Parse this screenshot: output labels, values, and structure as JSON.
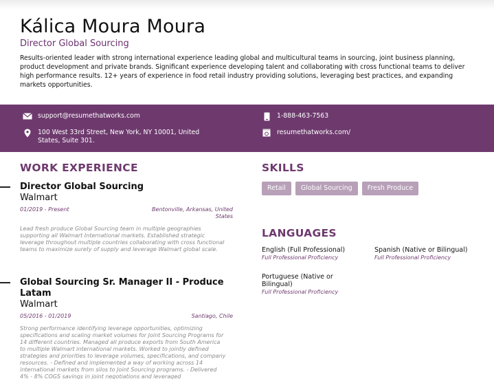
{
  "header": {
    "name": "Kálica Moura Moura",
    "title": "Director Global Sourcing",
    "summary": "Results-oriented leader with strong international experience leading global and multicultural teams in sourcing, joint business planning, product development and private brands. Significant experience developing talent and collaborating with cross functional teams to deliver high performance results. 12+ years of experience in food retail industry providing solutions, leveraging best practices, and expanding markets opportunities."
  },
  "contact": {
    "email": "support@resumethatworks.com",
    "address": "100 West 33rd Street, New York, NY 10001, United States, Suite 301.",
    "phone": "1-888-463-7563",
    "website": "resumethatworks.com/",
    "icons": [
      "envelope-icon",
      "location-pin-icon",
      "phone-icon",
      "web-icon"
    ],
    "bar_color": "#6e3a6e"
  },
  "work": {
    "heading": "WORK EXPERIENCE",
    "jobs": [
      {
        "title": "Director Global Sourcing",
        "company": "Walmart",
        "dates": "01/2019 - Present",
        "location": "Bentonville, Arkansas, United States",
        "description": "Lead fresh produce Global Sourcing team in multiple geographies supporting all Walmart International markets. Established strategic leverage throughout multiple countries collaborating with cross functional teams to maximize surety of supply and leverage Walmart global scale."
      },
      {
        "title": "Global Sourcing Sr. Manager II - Produce Latam",
        "company": "Walmart",
        "dates": "05/2016 - 01/2019",
        "location": "Santiago, Chile",
        "description": "Strong performance identifying leverage opportunities, optimizing specifications and scaling market volumes for Joint Sourcing Programs for 14 different countries. Managed all produce exports from South America to multiple Walmart international markets. Worked to jointly defined strategies and priorities to leverage volumes, specifications, and company resources. - Defined and implemented a way of working across 14 international markets from silos to Joint Sourcing programs. - Delivered 4% - 8% COGS savings in joint negotiations and leveraged"
      }
    ]
  },
  "skills": {
    "heading": "SKILLS",
    "items": [
      "Retail",
      "Global Sourcing",
      "Fresh Produce"
    ],
    "chip_color": "#b7a0b8"
  },
  "languages": {
    "heading": "LANGUAGES",
    "items": [
      {
        "name": "English (Full Professional)",
        "level": "Full Professional Proficiency"
      },
      {
        "name": "Spanish (Native or Bilingual)",
        "level": "Full Professional Proficiency"
      },
      {
        "name": "Portuguese (Native or Bilingual)",
        "level": "Full Professional Proficiency"
      }
    ]
  },
  "accent_color": "#6e3a6e"
}
